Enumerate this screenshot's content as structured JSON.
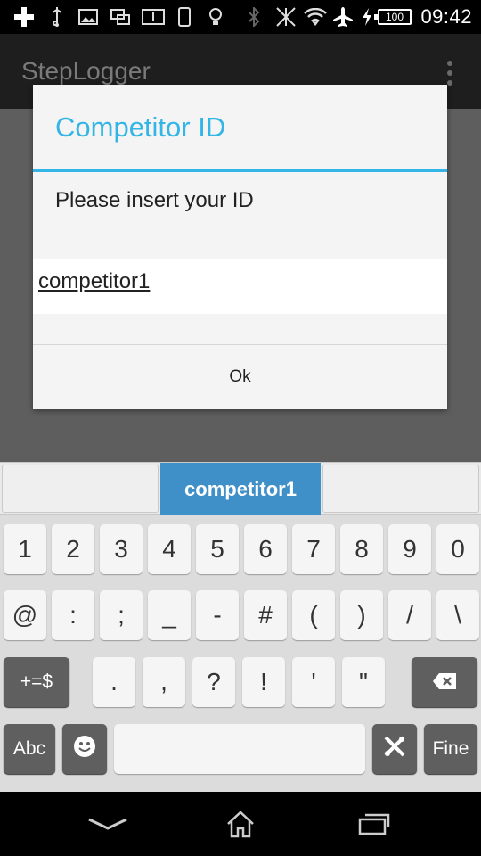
{
  "status_bar": {
    "battery_level": "100",
    "time": "09:42",
    "icons": [
      "add-icon",
      "usb-icon",
      "image-icon",
      "screen-mirror-icon",
      "info-icon",
      "phone-icon",
      "bulb-icon",
      "bluetooth-icon",
      "no-data-icon",
      "wifi-icon",
      "airplane-icon",
      "charging-icon",
      "battery-icon"
    ]
  },
  "app_bar": {
    "title": "StepLogger",
    "overflow_icon": "overflow-menu-icon"
  },
  "dialog": {
    "title": "Competitor ID",
    "message": "Please insert your ID",
    "input_value": "competitor1",
    "ok_label": "Ok",
    "accent_color": "#33b5e5"
  },
  "keyboard": {
    "suggestion": "competitor1",
    "suggestion_color": "#3f8fc9",
    "row1": [
      "1",
      "2",
      "3",
      "4",
      "5",
      "6",
      "7",
      "8",
      "9",
      "0"
    ],
    "row2": [
      "@",
      ":",
      ";",
      "_",
      "-",
      "#",
      "(",
      ")",
      "/",
      "\\"
    ],
    "row3": {
      "switch_label": "+=$",
      "keys": [
        ".",
        ",",
        "?",
        "!",
        "'",
        "\""
      ],
      "backspace_icon": "backspace-icon"
    },
    "row4": {
      "abc_label": "Abc",
      "emoji_icon": "emoji-icon",
      "space": "",
      "settings_icon": "tools-icon",
      "done_label": "Fine"
    }
  },
  "nav_bar": {
    "icons": [
      "back-chevron-icon",
      "home-icon",
      "recent-apps-icon"
    ]
  }
}
